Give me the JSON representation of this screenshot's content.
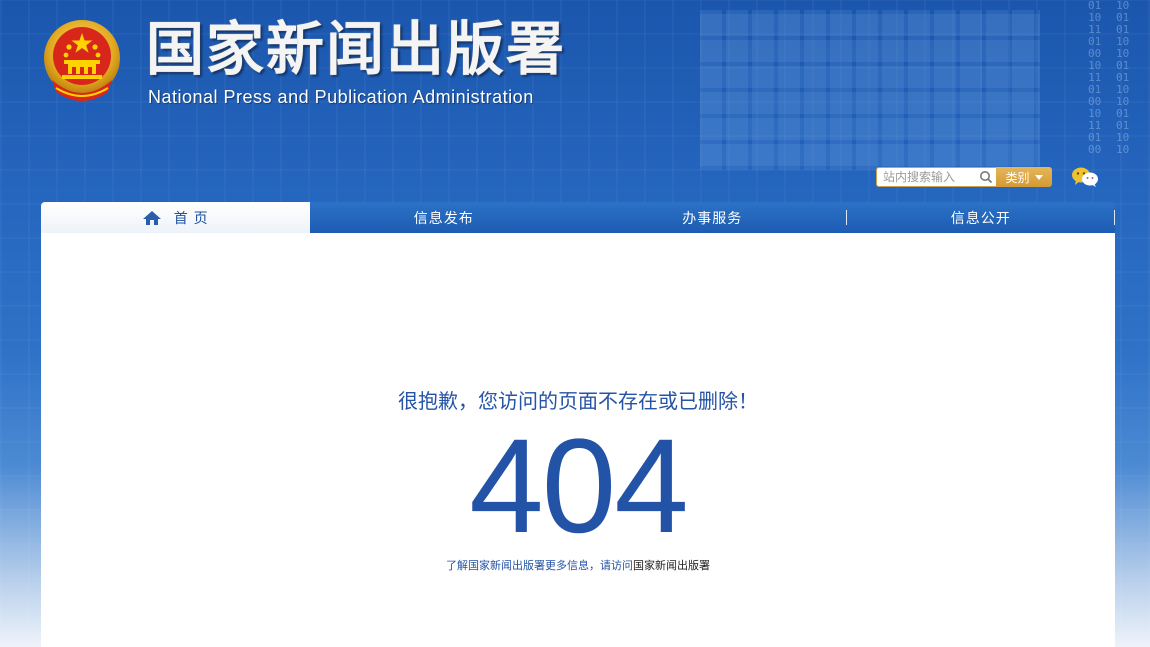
{
  "header": {
    "title": "国家新闻出版署",
    "subtitle": "National  Press and Publication Administration"
  },
  "search": {
    "placeholder": "站内搜索输入",
    "category_label": "类别"
  },
  "nav": {
    "items": [
      {
        "label": "首 页"
      },
      {
        "label": "信息发布"
      },
      {
        "label": "办事服务"
      },
      {
        "label": "信息公开"
      }
    ]
  },
  "main": {
    "message": "很抱歉，您访问的页面不存在或已删除！",
    "code": "404",
    "more_prefix": "了解国家新闻出版署更多信息，请访问",
    "more_link": "国家新闻出版署"
  },
  "colors": {
    "brand_blue": "#2253a6",
    "accent_gold": "#d39a34"
  },
  "icons": [
    "national-emblem-icon",
    "search-icon",
    "chevron-down-icon",
    "wechat-icon",
    "home-icon"
  ]
}
